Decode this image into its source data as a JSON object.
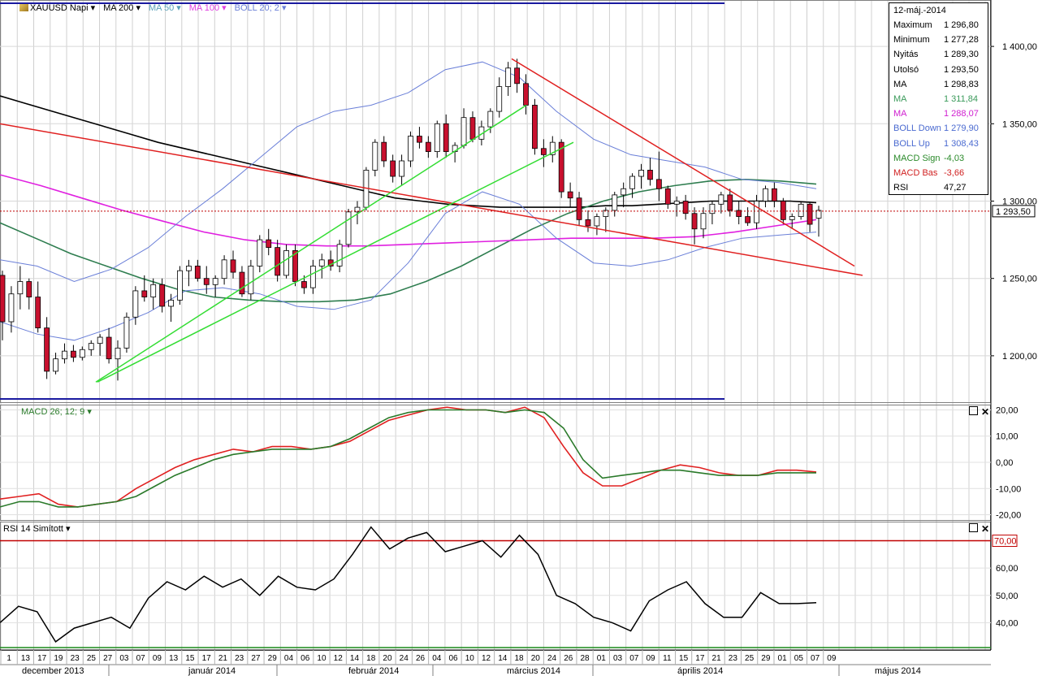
{
  "legend": [
    {
      "label": "XAUUSD Napi",
      "color": "#000000",
      "icon": "gold-bar-icon"
    },
    {
      "label": "MA 200",
      "color": "#000000"
    },
    {
      "label": "MA 50",
      "color": "#5aa0b8"
    },
    {
      "label": "MA 100",
      "color": "#e040e0"
    },
    {
      "label": "BOLL 20; 2",
      "color": "#6a7fd8"
    }
  ],
  "info_panel": {
    "date": "12-máj.-2014",
    "rows": [
      {
        "key": "Maximum",
        "value": "1 296,80",
        "color": "#000000"
      },
      {
        "key": "Minimum",
        "value": "1 277,28",
        "color": "#000000"
      },
      {
        "key": "Nyitás",
        "value": "1 289,30",
        "color": "#000000"
      },
      {
        "key": "Utolsó",
        "value": "1 293,50",
        "color": "#000000"
      },
      {
        "key": "MA",
        "value": "1 298,83",
        "color": "#000000"
      },
      {
        "key": "MA",
        "value": "1 311,84",
        "color": "#3a9a5a"
      },
      {
        "key": "MA",
        "value": "1 288,07",
        "color": "#d020d0"
      },
      {
        "key": "BOLL Down",
        "value": "1 279,90",
        "color": "#4a6ad0"
      },
      {
        "key": "BOLL Up",
        "value": "1 308,43",
        "color": "#4a6ad0"
      },
      {
        "key": "MACD Sign",
        "value": "-4,03",
        "color": "#2a8a2a"
      },
      {
        "key": "MACD Bas",
        "value": "-3,66",
        "color": "#d02020"
      },
      {
        "key": "RSI",
        "value": "47,27",
        "color": "#000000"
      }
    ]
  },
  "macd_label": "MACD 26; 12; 9",
  "rsi_label": "RSI 14 Simított",
  "colors": {
    "up_candle": "#ffffff",
    "down_candle": "#c8102e",
    "ma200": "#000000",
    "ma50": "#2e7d4f",
    "ma100": "#e020e0",
    "boll": "#6a7fd8",
    "trend_red": "#e02020",
    "trend_green": "#33dd33",
    "macd_line": "#e02020",
    "macd_signal": "#2a7a2a",
    "rsi_line": "#000000",
    "rsi_level": "#c00000",
    "channel_blue": "#1a1aa0",
    "last_price_line": "#c00000"
  },
  "chart_data": [
    {
      "type": "candlestick",
      "title": "XAUUSD Napi",
      "y_ticks": [
        "1 200,00",
        "1 250,00",
        "1 300,00",
        "1 350,00",
        "1 400,00"
      ],
      "ylim": [
        1170,
        1430
      ],
      "last_price_label": "1 293,50",
      "x_day_labels": [
        "1",
        "13",
        "17",
        "19",
        "23",
        "25",
        "27",
        "03",
        "07",
        "09",
        "13",
        "15",
        "17",
        "21",
        "23",
        "27",
        "29",
        "04",
        "06",
        "10",
        "12",
        "14",
        "18",
        "20",
        "24",
        "26",
        "04",
        "06",
        "10",
        "12",
        "14",
        "18",
        "20",
        "24",
        "26",
        "28",
        "01",
        "03",
        "07",
        "09",
        "11",
        "15",
        "17",
        "21",
        "23",
        "25",
        "29",
        "01",
        "05",
        "07",
        "09"
      ],
      "month_labels": [
        "december 2013",
        "január 2014",
        "február 2014",
        "március 2014",
        "április 2014",
        "május 2014"
      ],
      "candles": [
        [
          1252,
          1255,
          1210,
          1222
        ],
        [
          1222,
          1245,
          1215,
          1240
        ],
        [
          1240,
          1258,
          1230,
          1248
        ],
        [
          1248,
          1250,
          1230,
          1238
        ],
        [
          1238,
          1248,
          1215,
          1218
        ],
        [
          1218,
          1225,
          1185,
          1190
        ],
        [
          1190,
          1202,
          1188,
          1198
        ],
        [
          1198,
          1208,
          1195,
          1203
        ],
        [
          1203,
          1207,
          1196,
          1199
        ],
        [
          1199,
          1206,
          1197,
          1204
        ],
        [
          1204,
          1210,
          1200,
          1208
        ],
        [
          1208,
          1214,
          1200,
          1212
        ],
        [
          1212,
          1218,
          1195,
          1198
        ],
        [
          1198,
          1210,
          1184,
          1205
        ],
        [
          1205,
          1228,
          1202,
          1225
        ],
        [
          1225,
          1245,
          1220,
          1242
        ],
        [
          1242,
          1252,
          1235,
          1238
        ],
        [
          1238,
          1250,
          1230,
          1246
        ],
        [
          1246,
          1250,
          1228,
          1232
        ],
        [
          1232,
          1240,
          1222,
          1236
        ],
        [
          1236,
          1258,
          1233,
          1255
        ],
        [
          1255,
          1262,
          1245,
          1258
        ],
        [
          1258,
          1262,
          1248,
          1250
        ],
        [
          1250,
          1258,
          1240,
          1246
        ],
        [
          1246,
          1252,
          1238,
          1250
        ],
        [
          1250,
          1265,
          1246,
          1262
        ],
        [
          1262,
          1268,
          1250,
          1254
        ],
        [
          1254,
          1258,
          1238,
          1240
        ],
        [
          1240,
          1262,
          1236,
          1258
        ],
        [
          1258,
          1278,
          1254,
          1275
        ],
        [
          1275,
          1282,
          1265,
          1270
        ],
        [
          1270,
          1275,
          1248,
          1252
        ],
        [
          1252,
          1272,
          1250,
          1268
        ],
        [
          1268,
          1272,
          1245,
          1248
        ],
        [
          1248,
          1252,
          1240,
          1244
        ],
        [
          1244,
          1262,
          1240,
          1258
        ],
        [
          1258,
          1266,
          1250,
          1262
        ],
        [
          1262,
          1268,
          1255,
          1258
        ],
        [
          1258,
          1275,
          1254,
          1272
        ],
        [
          1272,
          1295,
          1270,
          1293
        ],
        [
          1293,
          1300,
          1285,
          1296
        ],
        [
          1296,
          1322,
          1294,
          1320
        ],
        [
          1320,
          1340,
          1316,
          1338
        ],
        [
          1338,
          1342,
          1322,
          1326
        ],
        [
          1326,
          1330,
          1312,
          1316
        ],
        [
          1316,
          1330,
          1310,
          1326
        ],
        [
          1326,
          1345,
          1322,
          1342
        ],
        [
          1342,
          1348,
          1334,
          1338
        ],
        [
          1338,
          1342,
          1328,
          1332
        ],
        [
          1332,
          1352,
          1328,
          1350
        ],
        [
          1350,
          1356,
          1328,
          1332
        ],
        [
          1332,
          1338,
          1325,
          1336
        ],
        [
          1336,
          1360,
          1334,
          1354
        ],
        [
          1354,
          1358,
          1338,
          1340
        ],
        [
          1340,
          1352,
          1336,
          1348
        ],
        [
          1348,
          1360,
          1344,
          1358
        ],
        [
          1358,
          1380,
          1354,
          1374
        ],
        [
          1374,
          1390,
          1368,
          1386
        ],
        [
          1386,
          1392,
          1370,
          1376
        ],
        [
          1376,
          1382,
          1356,
          1362
        ],
        [
          1362,
          1366,
          1330,
          1334
        ],
        [
          1334,
          1340,
          1322,
          1330
        ],
        [
          1330,
          1342,
          1325,
          1338
        ],
        [
          1338,
          1340,
          1302,
          1306
        ],
        [
          1306,
          1312,
          1296,
          1302
        ],
        [
          1302,
          1306,
          1284,
          1288
        ],
        [
          1288,
          1294,
          1280,
          1284
        ],
        [
          1284,
          1292,
          1278,
          1290
        ],
        [
          1290,
          1296,
          1280,
          1294
        ],
        [
          1294,
          1306,
          1290,
          1304
        ],
        [
          1304,
          1312,
          1296,
          1308
        ],
        [
          1308,
          1318,
          1302,
          1316
        ],
        [
          1316,
          1324,
          1308,
          1320
        ],
        [
          1320,
          1328,
          1310,
          1314
        ],
        [
          1314,
          1332,
          1300,
          1308
        ],
        [
          1308,
          1310,
          1295,
          1298
        ],
        [
          1298,
          1303,
          1290,
          1300
        ],
        [
          1300,
          1304,
          1288,
          1292
        ],
        [
          1292,
          1296,
          1272,
          1282
        ],
        [
          1282,
          1296,
          1276,
          1292
        ],
        [
          1292,
          1300,
          1285,
          1298
        ],
        [
          1298,
          1306,
          1292,
          1304
        ],
        [
          1304,
          1308,
          1290,
          1294
        ],
        [
          1294,
          1300,
          1285,
          1290
        ],
        [
          1290,
          1296,
          1284,
          1286
        ],
        [
          1286,
          1304,
          1282,
          1300
        ],
        [
          1300,
          1310,
          1296,
          1308
        ],
        [
          1308,
          1312,
          1296,
          1300
        ],
        [
          1300,
          1302,
          1285,
          1288
        ],
        [
          1288,
          1292,
          1282,
          1290
        ],
        [
          1290,
          1300,
          1288,
          1298
        ],
        [
          1298,
          1299,
          1280,
          1285
        ],
        [
          1289,
          1297,
          1277,
          1294
        ]
      ],
      "series": [
        {
          "name": "MA 200",
          "values": [
            1368,
            1363,
            1358,
            1353,
            1348,
            1343,
            1338,
            1334,
            1330,
            1326,
            1322,
            1318,
            1314,
            1310,
            1306,
            1302,
            1300,
            1298,
            1297,
            1296,
            1296,
            1296,
            1296,
            1297,
            1297,
            1298,
            1299,
            1300,
            1300,
            1300,
            1300,
            1299
          ]
        },
        {
          "name": "MA 50",
          "values": [
            1286,
            1276,
            1266,
            1258,
            1250,
            1243,
            1238,
            1236,
            1235,
            1235,
            1236,
            1240,
            1248,
            1258,
            1270,
            1282,
            1292,
            1300,
            1306,
            1310,
            1313,
            1314,
            1313,
            1311
          ]
        },
        {
          "name": "MA 100",
          "values": [
            1317,
            1310,
            1302,
            1294,
            1287,
            1280,
            1275,
            1272,
            1271,
            1271,
            1272,
            1273,
            1274,
            1275,
            1276,
            1276,
            1276,
            1277,
            1280,
            1284,
            1288
          ]
        },
        {
          "name": "BOLL Up",
          "values": [
            1262,
            1258,
            1248,
            1256,
            1270,
            1290,
            1308,
            1328,
            1348,
            1358,
            1362,
            1370,
            1385,
            1390,
            1380,
            1358,
            1340,
            1330,
            1326,
            1322,
            1314,
            1312,
            1308
          ]
        },
        {
          "name": "BOLL Down",
          "values": [
            1222,
            1214,
            1210,
            1218,
            1228,
            1242,
            1244,
            1240,
            1232,
            1230,
            1236,
            1260,
            1292,
            1306,
            1298,
            1276,
            1260,
            1258,
            1262,
            1270,
            1276,
            1278,
            1280
          ]
        }
      ],
      "trendlines_red": [
        [
          0,
          1350,
          1062,
          1252
        ],
        [
          630,
          1392,
          1052,
          1258
        ]
      ],
      "trendlines_green": [
        [
          118,
          1183,
          648,
          1362
        ],
        [
          120,
          1183,
          706,
          1338
        ]
      ]
    },
    {
      "type": "line",
      "title": "MACD 26; 12; 9",
      "y_ticks": [
        "20,00",
        "10,00",
        "0,00",
        "-10,00",
        "-20,00"
      ],
      "ylim": [
        -22,
        22
      ],
      "series": [
        {
          "name": "MACD Bas",
          "values": [
            -14,
            -13,
            -12,
            -16,
            -17,
            -16,
            -15,
            -10,
            -6,
            -2,
            1,
            3,
            5,
            4,
            6,
            6,
            5,
            6,
            8,
            12,
            16,
            18,
            20,
            21,
            20,
            20,
            19,
            21,
            17,
            6,
            -4,
            -9,
            -9,
            -6,
            -3,
            -1,
            -2,
            -4,
            -5,
            -5,
            -3,
            -3,
            -3.7
          ]
        },
        {
          "name": "MACD Sign",
          "values": [
            -17,
            -15,
            -15,
            -17,
            -17,
            -16,
            -15,
            -13,
            -9,
            -5,
            -2,
            1,
            3,
            4,
            5,
            5,
            5,
            6,
            9,
            13,
            17,
            19,
            20,
            20,
            20,
            20,
            19,
            20,
            19,
            13,
            1,
            -6,
            -5,
            -4,
            -3,
            -3,
            -4,
            -5,
            -5,
            -5,
            -4,
            -4,
            -4.0
          ]
        }
      ]
    },
    {
      "type": "line",
      "title": "RSI 14 Simított",
      "y_ticks": [
        "70,00",
        "60,00",
        "50,00",
        "40,00"
      ],
      "ylim": [
        30,
        77
      ],
      "level": "70,00",
      "series": [
        {
          "name": "RSI",
          "values": [
            40,
            46,
            44,
            33,
            38,
            40,
            42,
            38,
            49,
            55,
            52,
            57,
            53,
            56,
            50,
            57,
            53,
            52,
            56,
            65,
            75,
            67,
            71,
            73,
            66,
            68,
            70,
            64,
            72,
            65,
            50,
            47,
            42,
            40,
            37,
            48,
            52,
            55,
            47,
            42,
            42,
            51,
            47,
            47,
            47.3
          ]
        }
      ]
    }
  ]
}
